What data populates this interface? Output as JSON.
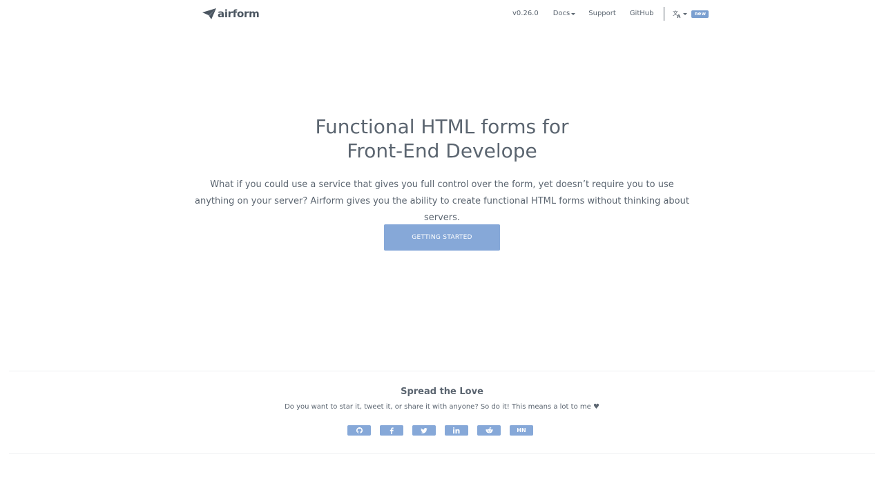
{
  "header": {
    "logo_text": "airform",
    "nav": {
      "version": "v0.26.0",
      "docs": "Docs",
      "support": "Support",
      "github": "GitHub",
      "language_icon": "translate-icon",
      "new_badge": "new"
    }
  },
  "hero": {
    "title_line1": "Functional HTML forms for",
    "title_line2": "Front-End Develope",
    "description": "What if you could use a service that gives you full control over the form, yet doesn’t require you to use anything on your server? Airform gives you the ability to create functional HTML forms without thinking about servers.",
    "cta_label": "GETTING STARTED"
  },
  "share": {
    "title": "Spread the Love",
    "description": "Do you want to star it, tweet it, or share it with anyone? So do it! This means a lot to me ♥",
    "buttons": [
      {
        "icon": "github-icon"
      },
      {
        "icon": "facebook-icon"
      },
      {
        "icon": "twitter-icon"
      },
      {
        "icon": "linkedin-icon"
      },
      {
        "icon": "reddit-icon"
      },
      {
        "label": "HN"
      }
    ]
  },
  "colors": {
    "accent": "#86a8d8",
    "text": "#5b6570",
    "badge": "#7a9fd0"
  }
}
